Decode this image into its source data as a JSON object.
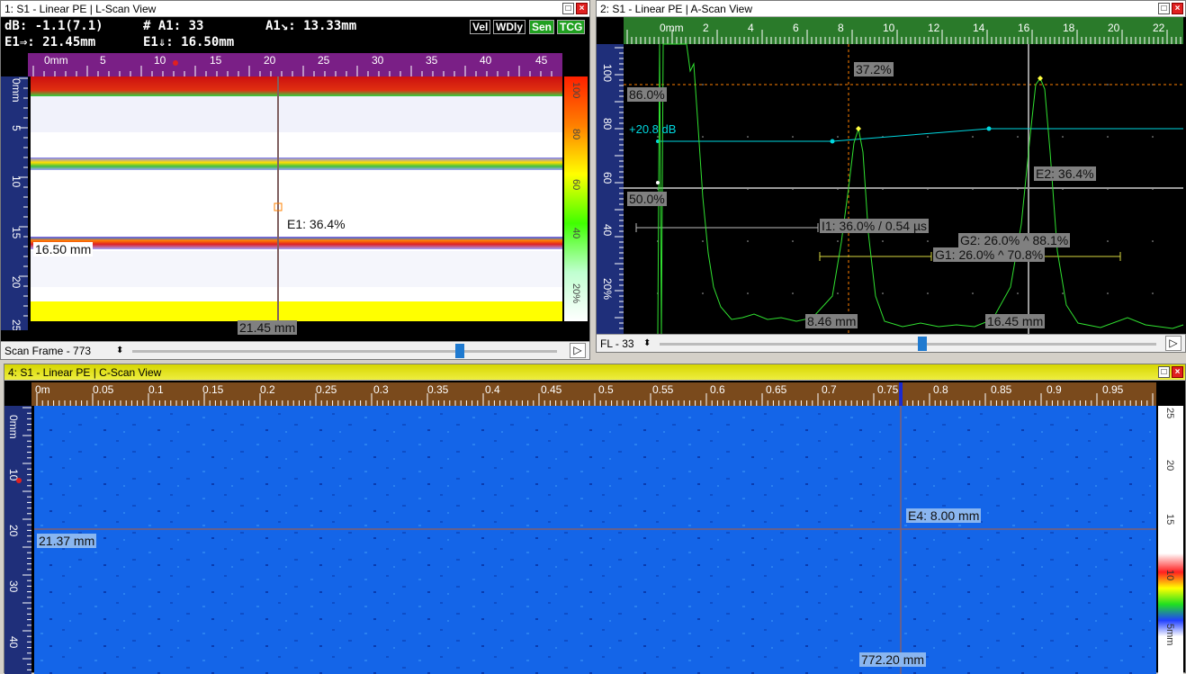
{
  "lscan": {
    "title": "1: S1 - Linear PE | L-Scan View",
    "db": "dB: -1.1(7.1)",
    "a1count": "# A1: 33",
    "a1depth": "A1↘: 13.33mm",
    "e1x": "E1⇒: 21.45mm",
    "e1y": "E1⇓: 16.50mm",
    "chips": [
      "Vel",
      "WDly",
      "Sen",
      "TCG"
    ],
    "hruler": [
      "0mm",
      "5",
      "10",
      "15",
      "20",
      "25",
      "30",
      "35",
      "40",
      "45"
    ],
    "vruler": [
      "0mm",
      "5",
      "10",
      "15",
      "20",
      "25"
    ],
    "palette": [
      "100",
      "80",
      "60",
      "40",
      "20%"
    ],
    "cursor_label": "E1: 36.4%",
    "depth_label": "16.50 mm",
    "pos_label": "21.45 mm",
    "status": "Scan Frame - 773"
  },
  "ascan": {
    "title": "2: S1 - Linear PE | A-Scan View",
    "hruler": [
      "0mm",
      "2",
      "4",
      "6",
      "8",
      "10",
      "12",
      "14",
      "16",
      "18",
      "20",
      "22"
    ],
    "yaxis": [
      "100",
      "80",
      "60",
      "40",
      "20%"
    ],
    "lbl_37": "37.2%",
    "lbl_86": "86.0%",
    "lbl_50": "50.0%",
    "tcg_db": "+20.8 dB",
    "e2": "E2: 36.4%",
    "i1": "I1: 36.0% / 0.54 µs",
    "g2": "G2: 26.0% ^ 88.1%",
    "g1": "G1: 26.0% ^ 70.8%",
    "m1": "8.46 mm",
    "m2": "16.45 mm",
    "status": "FL - 33"
  },
  "cscan": {
    "title": "4: S1 - Linear PE | C-Scan View",
    "hruler": [
      "0m",
      "0.05",
      "0.1",
      "0.15",
      "0.2",
      "0.25",
      "0.3",
      "0.35",
      "0.4",
      "0.45",
      "0.5",
      "0.55",
      "0.6",
      "0.65",
      "0.7",
      "0.75",
      "0.8",
      "0.85",
      "0.9",
      "0.95"
    ],
    "vruler": [
      "0mm",
      "10",
      "20",
      "30",
      "40"
    ],
    "palette": [
      "25",
      "20",
      "15",
      "10",
      "5mm"
    ],
    "y_label": "21.37 mm",
    "e4": "E4: 8.00 mm",
    "x_label": "772.20 mm"
  }
}
